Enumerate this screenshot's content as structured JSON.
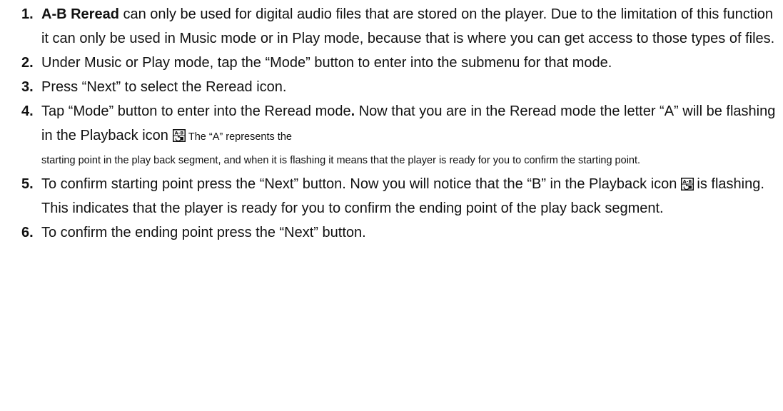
{
  "steps": [
    {
      "number": "1.",
      "bold_lead": "A-B Reread",
      "text": " can only be used for digital audio files that are stored on the player. Due to the limitation of this function it can only be used in Music mode or in Play mode, because that is where you can get access to those types of files."
    },
    {
      "number": "2.",
      "text": "Under Music or Play mode, tap the “Mode” button to enter into the submenu for that mode."
    },
    {
      "number": "3.",
      "text": "Press “Next” to select the Reread icon."
    },
    {
      "number": "4.",
      "text_before_bold": "Tap “Mode” button to enter into the Reread mode",
      "bold_period": ".",
      "text_after_bold": " Now that you are in the Reread mode the letter “A” will be flashing in the Playback icon",
      "small_inline": "The “A” represents the",
      "small_block": "starting point in the play back segment, and when it is flashing it means that the player is ready for you to confirm the starting point.",
      "icon": "ab-reread-icon"
    },
    {
      "number": "5.",
      "text_before_icon": "To confirm starting point press the “Next” button. Now you will notice that the “B” in the Playback icon",
      "text_after_icon": "is flashing.   This indicates that the player is ready for you to confirm the ending point of the play back segment.",
      "icon": "ab-reread-icon"
    },
    {
      "number": "6.",
      "text": "To confirm the ending point press the “Next” button."
    }
  ]
}
